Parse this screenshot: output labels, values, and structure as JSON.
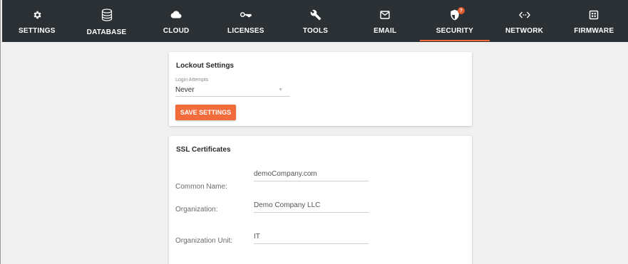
{
  "nav": {
    "items": [
      {
        "label": "SETTINGS",
        "icon": "gear-icon"
      },
      {
        "label": "DATABASE",
        "icon": "database-icon"
      },
      {
        "label": "CLOUD",
        "icon": "cloud-icon"
      },
      {
        "label": "LICENSES",
        "icon": "key-icon"
      },
      {
        "label": "TOOLS",
        "icon": "wrench-icon"
      },
      {
        "label": "EMAIL",
        "icon": "envelope-icon"
      },
      {
        "label": "SECURITY",
        "icon": "shield-icon",
        "active": true,
        "badge": "?"
      },
      {
        "label": "NETWORK",
        "icon": "code-arrows-icon"
      },
      {
        "label": "FIRMWARE",
        "icon": "chip-icon"
      }
    ],
    "accent_color": "#f26b3a",
    "background_color": "#2b3034"
  },
  "lockout": {
    "title": "Lockout Settings",
    "login_attempts_label": "Login Attempts",
    "login_attempts_value": "Never",
    "save_label": "SAVE SETTINGS"
  },
  "ssl": {
    "title": "SSL Certificates",
    "fields": [
      {
        "label": "Common Name:",
        "value": "demoCompany.com"
      },
      {
        "label": "Organization:",
        "value": "Demo Company LLC"
      },
      {
        "label": "Organization Unit:",
        "value": "IT"
      }
    ]
  }
}
